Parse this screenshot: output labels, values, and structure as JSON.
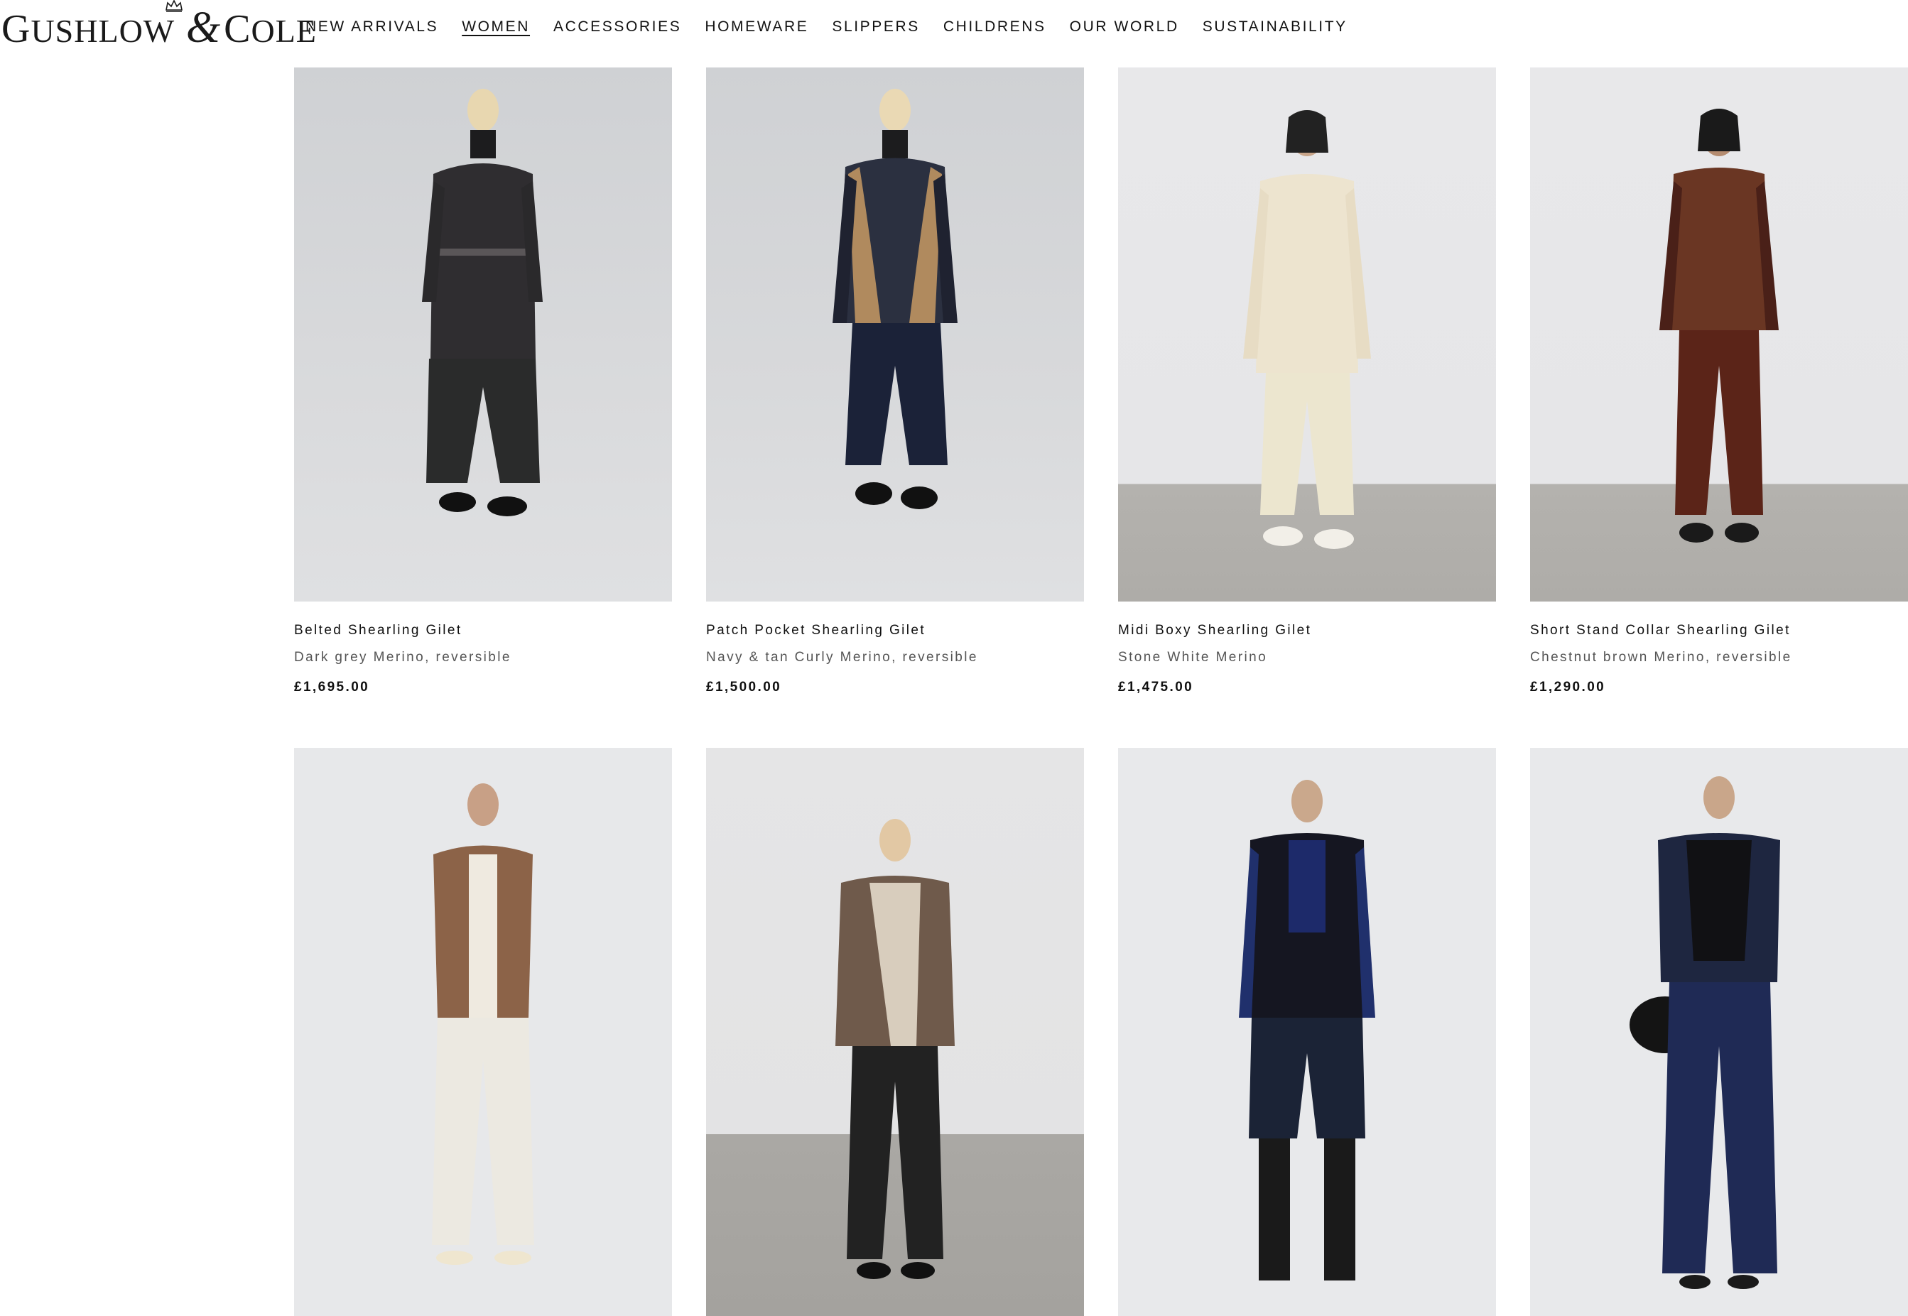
{
  "brand": {
    "logo_text_1": "G",
    "logo_text_2": "USHLOW",
    "logo_amp": "&",
    "logo_text_3": "C",
    "logo_text_4": "OLE"
  },
  "nav": {
    "items": [
      {
        "label": "NEW ARRIVALS",
        "active": false
      },
      {
        "label": "WOMEN",
        "active": true
      },
      {
        "label": "ACCESSORIES",
        "active": false
      },
      {
        "label": "HOMEWARE",
        "active": false
      },
      {
        "label": "SLIPPERS",
        "active": false
      },
      {
        "label": "CHILDRENS",
        "active": false
      },
      {
        "label": "OUR WORLD",
        "active": false
      },
      {
        "label": "SUSTAINABILITY",
        "active": false
      }
    ]
  },
  "products": [
    {
      "title": "Belted Shearling Gilet",
      "subtitle": "Dark grey Merino, reversible",
      "price": "£1,695.00"
    },
    {
      "title": "Patch Pocket Shearling Gilet",
      "subtitle": "Navy & tan Curly Merino, reversible",
      "price": "£1,500.00"
    },
    {
      "title": "Midi Boxy Shearling Gilet",
      "subtitle": "Stone White Merino",
      "price": "£1,475.00"
    },
    {
      "title": "Short Stand Collar Shearling Gilet",
      "subtitle": "Chestnut brown Merino, reversible",
      "price": "£1,290.00"
    },
    {
      "title": "",
      "subtitle": "",
      "price": ""
    },
    {
      "title": "",
      "subtitle": "",
      "price": ""
    },
    {
      "title": "",
      "subtitle": "",
      "price": ""
    },
    {
      "title": "",
      "subtitle": "",
      "price": ""
    }
  ],
  "colors": {
    "background": "#ffffff",
    "text": "#111111",
    "muted_text": "#555555"
  }
}
